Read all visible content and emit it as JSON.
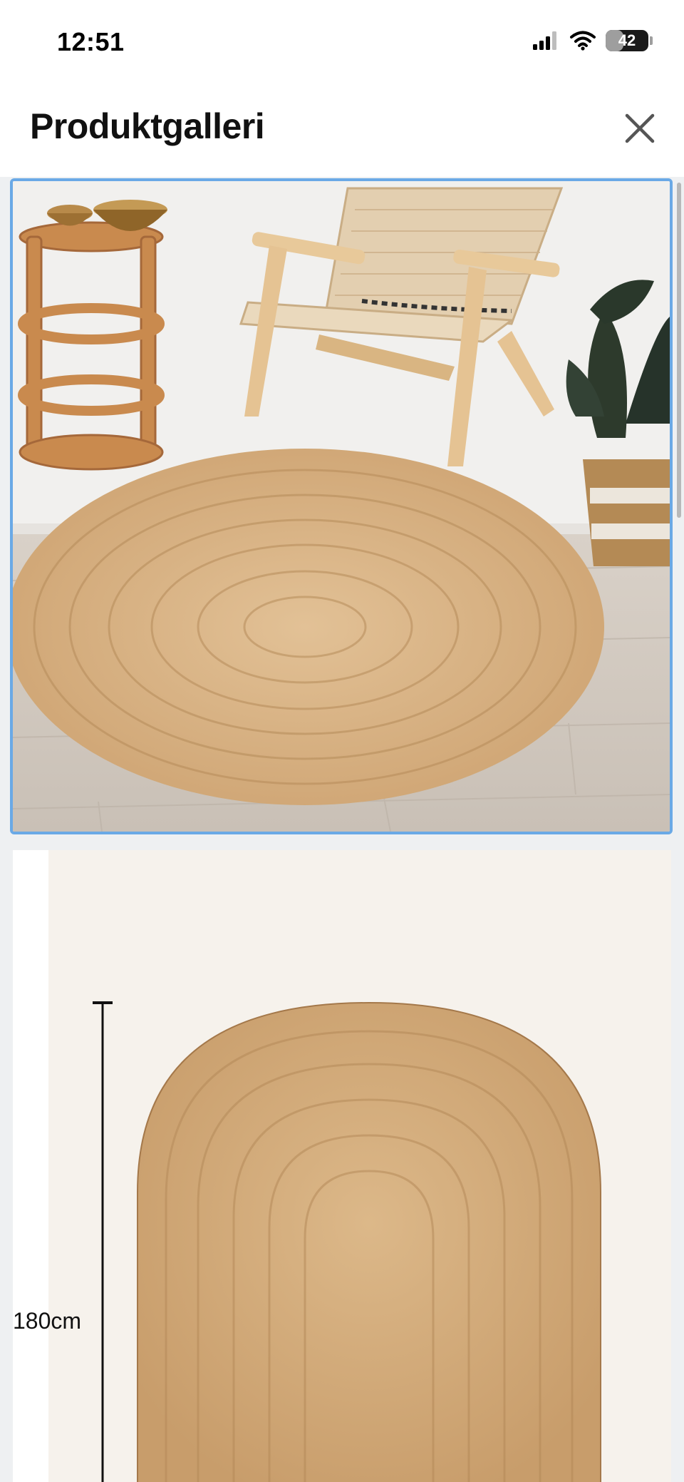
{
  "status_bar": {
    "time": "12:51",
    "battery_level": "42",
    "icons": [
      "cellular-signal-icon",
      "wifi-icon",
      "battery-icon"
    ]
  },
  "header": {
    "title": "Produktgalleri",
    "close_icon": "close-icon"
  },
  "gallery": {
    "images": [
      {
        "selected": true
      },
      {
        "selected": false,
        "dimension_label": "180cm"
      }
    ]
  },
  "colors": {
    "selected_border": "#6aa9e6",
    "title_text": "#111111",
    "rug": "#d9b27e"
  }
}
